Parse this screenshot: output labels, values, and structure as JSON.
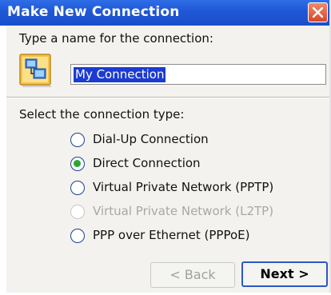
{
  "window": {
    "title": "Make New Connection"
  },
  "name_section": {
    "prompt": "Type a name for the connection:",
    "value": "My Connection"
  },
  "type_section": {
    "prompt": "Select the connection type:",
    "options": [
      {
        "label": "Dial-Up Connection",
        "selected": false,
        "enabled": true
      },
      {
        "label": "Direct Connection",
        "selected": true,
        "enabled": true
      },
      {
        "label": "Virtual Private Network (PPTP)",
        "selected": false,
        "enabled": true
      },
      {
        "label": "Virtual Private Network (L2TP)",
        "selected": false,
        "enabled": false
      },
      {
        "label": "PPP over Ethernet (PPPoE)",
        "selected": false,
        "enabled": true
      }
    ]
  },
  "buttons": {
    "back_label": "< Back",
    "next_label": "Next >"
  },
  "icons": {
    "close": "close-icon",
    "connection": "network-connection-icon"
  },
  "colors": {
    "titlebar": "#1f57d6",
    "selection": "#1c3bd1",
    "radio_selected": "#2aa830"
  }
}
